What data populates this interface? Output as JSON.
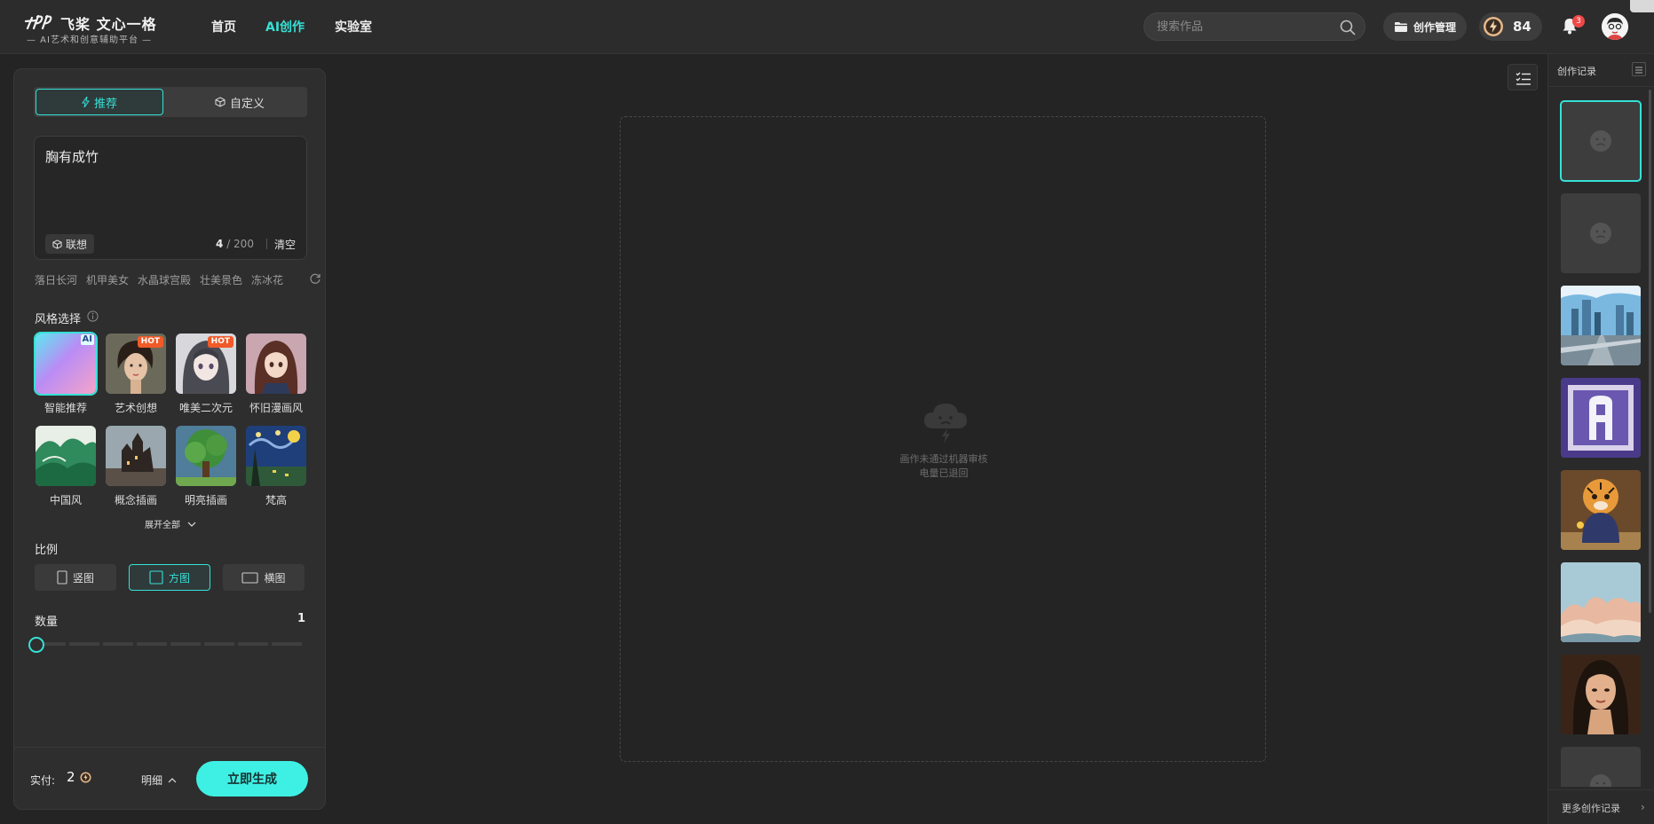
{
  "header": {
    "logo_title": "飞桨 文心一格",
    "logo_subtitle": "— AI艺术和创意辅助平台 —",
    "nav": [
      "首页",
      "AI创作",
      "实验室"
    ],
    "active_nav": "AI创作",
    "search_placeholder": "搜索作品",
    "manage_label": "创作管理",
    "points": "84",
    "notification_count": "3"
  },
  "left_panel": {
    "tabs": [
      "推荐",
      "自定义"
    ],
    "prompt_text": "胸有成竹",
    "assoc_label": "联想",
    "char_count": "4",
    "char_limit": "/ 200",
    "clear_label": "清空",
    "suggestions": [
      "落日长河",
      "机甲美女",
      "水晶球宫殿",
      "壮美景色",
      "冻冰花"
    ],
    "style_title": "风格选择",
    "styles": [
      {
        "name": "智能推荐",
        "badge": "AI"
      },
      {
        "name": "艺术创想",
        "badge": "HOT"
      },
      {
        "name": "唯美二次元",
        "badge": "HOT"
      },
      {
        "name": "怀旧漫画风",
        "badge": ""
      },
      {
        "name": "中国风",
        "badge": ""
      },
      {
        "name": "概念插画",
        "badge": ""
      },
      {
        "name": "明亮插画",
        "badge": ""
      },
      {
        "name": "梵高",
        "badge": ""
      }
    ],
    "expand_label": "展开全部",
    "ratio_title": "比例",
    "ratios": [
      "竖图",
      "方图",
      "横图"
    ],
    "active_ratio": "方图",
    "quantity_title": "数量",
    "quantity_value": "1",
    "quantity_level_fraction": 0,
    "pay_label": "实付:",
    "pay_value": "2",
    "detail_label": "明细",
    "generate_label": "立即生成"
  },
  "canvas": {
    "message_line1": "画作未通过机器审核",
    "message_line2": "电量已退回"
  },
  "history": {
    "title": "创作记录",
    "items": [
      "failed",
      "failed",
      "city",
      "letter-a",
      "tiger",
      "clouds",
      "portrait",
      "failed"
    ],
    "more_label": "更多创作记录"
  },
  "colors": {
    "accent": "#36e0d6",
    "generate_bg": "#3ef0e4",
    "badge_hot": "#f05a28",
    "notification": "#f04848"
  }
}
